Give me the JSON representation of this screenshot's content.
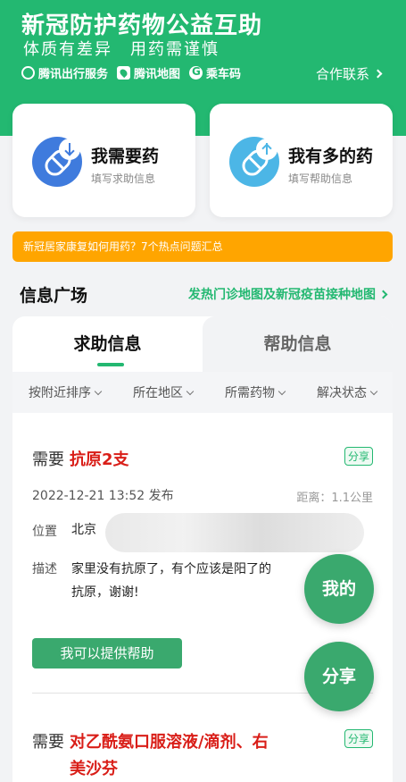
{
  "hero": {
    "title": "新冠防护药物公益互助",
    "subtitle": "体质有差异　用药需谨慎",
    "partners": [
      "腾讯出行服务",
      "腾讯地图",
      "乘车码"
    ],
    "contact": "合作联系"
  },
  "cards": {
    "need": {
      "title": "我需要药",
      "subtitle": "填写求助信息"
    },
    "have": {
      "title": "我有多的药",
      "subtitle": "填写帮助信息"
    }
  },
  "banner": "新冠居家康复如何用药？7个热点问题汇总",
  "section": {
    "title": "信息广场",
    "link": "发热门诊地图及新冠疫苗接种地图"
  },
  "tabs": {
    "help_request": "求助信息",
    "help_offer": "帮助信息"
  },
  "filters": [
    "按附近排序",
    "所在地区",
    "所需药物",
    "解决状态"
  ],
  "posts": [
    {
      "label": "需要",
      "item": "抗原2支",
      "share": "分享",
      "time": "2022-12-21 13:52 发布",
      "distance": "距离：1.1公里",
      "location_key": "位置",
      "location": "北京",
      "desc_key": "描述",
      "desc_line1": "家里没有抗原了，有个应该是阳了的",
      "desc_line2": "抗原，谢谢!",
      "help_button": "我可以提供帮助"
    },
    {
      "label": "需要",
      "item_line1": "对乙酰氨口服溶液/滴剂、右",
      "item_line2": "美沙芬",
      "share": "分享"
    }
  ],
  "fabs": {
    "mine": "我的",
    "share": "分享"
  },
  "colors": {
    "primary": "#23b871",
    "banner": "#ffa500",
    "highlight": "#d91e18"
  }
}
